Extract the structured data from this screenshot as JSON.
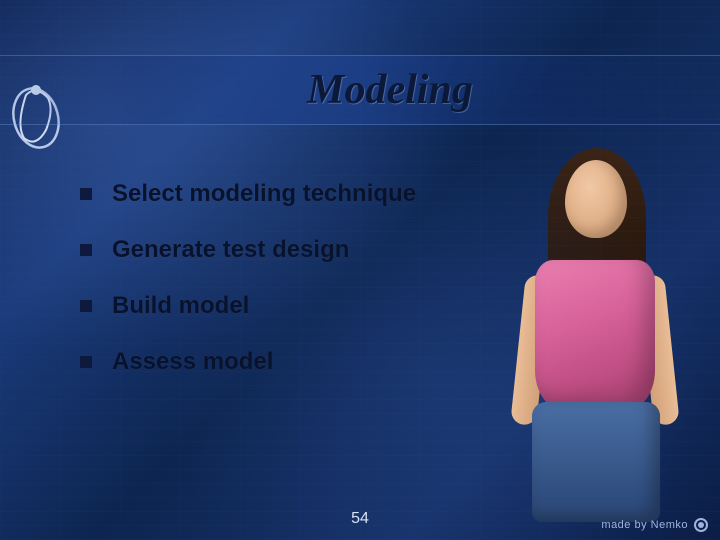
{
  "title": "Modeling",
  "bullets": [
    "Select modeling technique",
    "Generate test design",
    "Build model",
    "Assess model"
  ],
  "page_number": "54",
  "brand": "made by Nemko"
}
